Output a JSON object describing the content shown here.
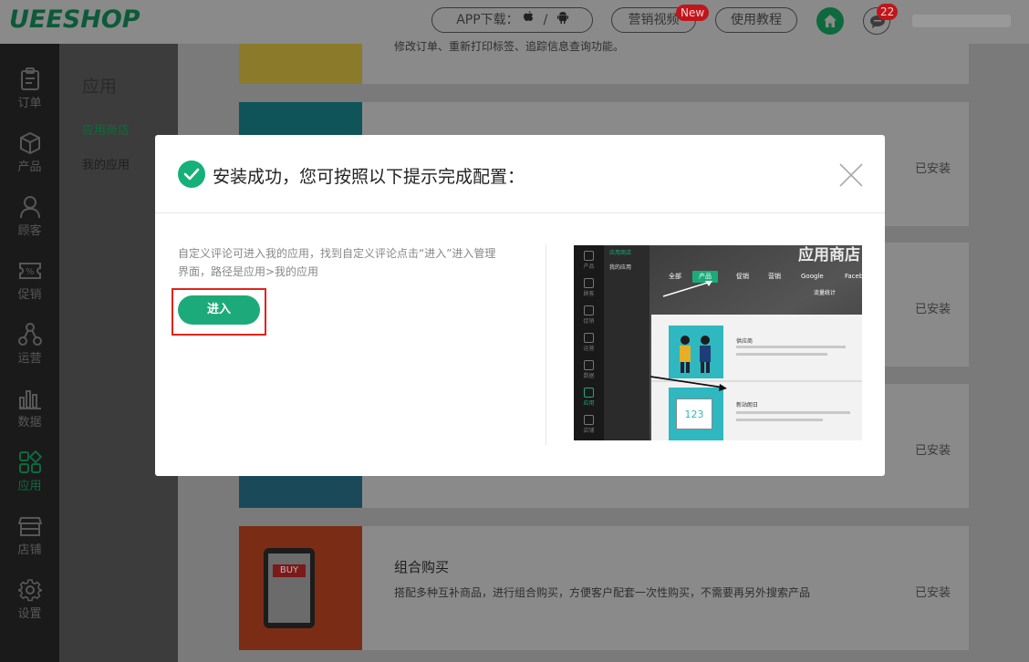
{
  "header": {
    "logo": "UEESHOP",
    "app_download_label": "APP下载：",
    "app_sep": "/",
    "marketing_video_label": "营销视频",
    "marketing_badge": "New",
    "tutorial_label": "使用教程",
    "message_count": "22"
  },
  "leftnav": {
    "items": [
      {
        "label": "订单",
        "icon": "clipboard-icon"
      },
      {
        "label": "产品",
        "icon": "box-icon"
      },
      {
        "label": "顾客",
        "icon": "user-icon"
      },
      {
        "label": "促销",
        "icon": "coupon-icon"
      },
      {
        "label": "运营",
        "icon": "network-icon"
      },
      {
        "label": "数据",
        "icon": "bar-chart-icon"
      },
      {
        "label": "应用",
        "icon": "apps-icon"
      },
      {
        "label": "店铺",
        "icon": "store-icon"
      },
      {
        "label": "设置",
        "icon": "gear-icon"
      }
    ],
    "active_index": 6
  },
  "subnav": {
    "title": "应用",
    "items": [
      {
        "label": "应用商店",
        "active": true
      },
      {
        "label": "我的应用",
        "active": false
      }
    ]
  },
  "cards": [
    {
      "title": "",
      "desc": "修改订单、重新打印标签、追踪信息查询功能。",
      "status": ""
    },
    {
      "title": "",
      "desc": "",
      "status": "已安装"
    },
    {
      "title": "",
      "desc": "",
      "status": "已安装"
    },
    {
      "title": "",
      "desc": "",
      "status": "已安装"
    },
    {
      "title": "组合购买",
      "desc": "搭配多种互补商品，进行组合购买，方便客户配套一次性购买，不需要再另外搜索产品",
      "status": "已安装",
      "thumb_text": "BUY"
    }
  ],
  "modal": {
    "title": "安装成功，您可按照以下提示完成配置：",
    "instruction": "自定义评论可进入我的应用，找到自定义评论点击“进入”进入管理界面，路径是应用>我的应用",
    "enter_button": "进入",
    "preview": {
      "title": "应用商店",
      "side_items": [
        "产品",
        "顾客",
        "促销",
        "运营",
        "数据",
        "应用",
        "店铺"
      ],
      "sub_items": [
        "应用商店",
        "我的应用"
      ],
      "tabs": [
        "全部",
        "产品",
        "促销",
        "营销",
        "Google",
        "Faceb"
      ],
      "subtab": "流量统计",
      "card1_title": "供应商",
      "card2_title": "新站朗日",
      "card2_num": "123"
    }
  },
  "colors": {
    "accent": "#1daa7a",
    "highlight_box": "#e2231a",
    "badge": "#c0161b"
  }
}
